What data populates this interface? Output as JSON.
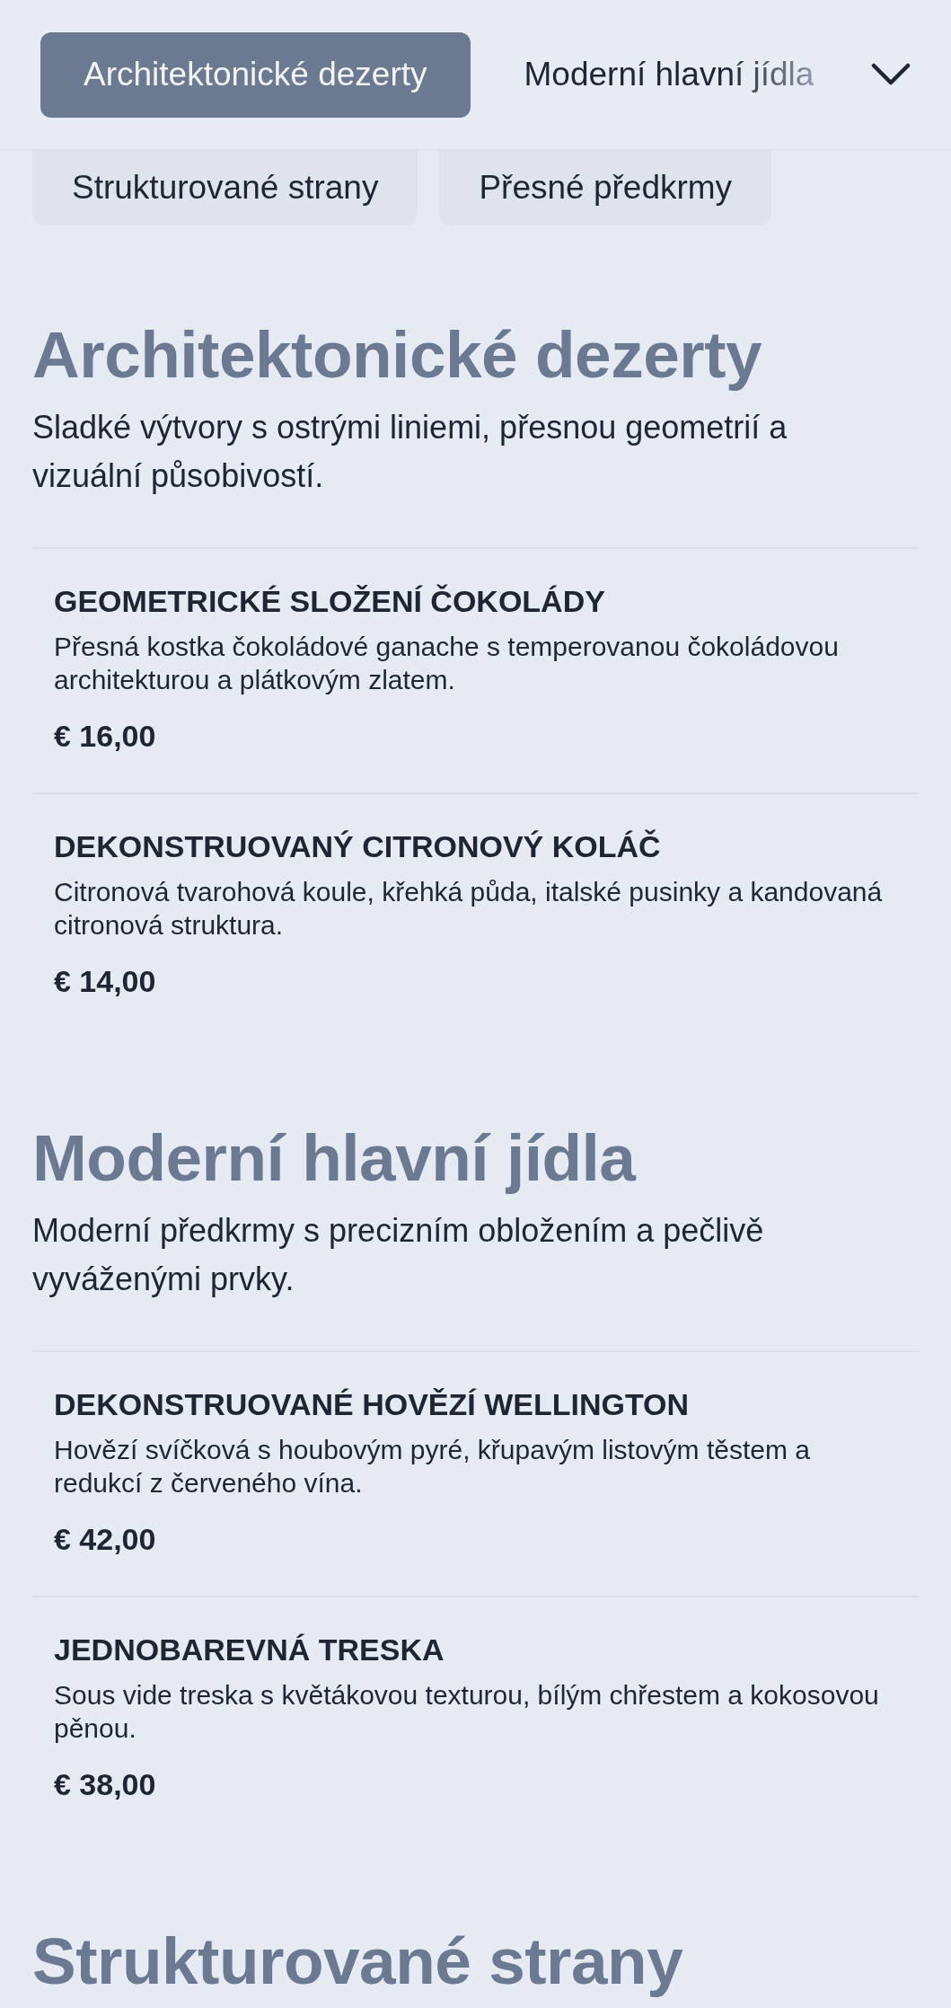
{
  "tabs": [
    {
      "label": "Architektonické dezerty",
      "selected": true
    },
    {
      "label": "Moderní hlavní jídla",
      "selected": false
    },
    {
      "label": "Strukturované strany",
      "selected": false
    },
    {
      "label": "Přesné předkrmy",
      "selected": false
    }
  ],
  "sections": [
    {
      "title": "Architektonické dezerty",
      "description": "Sladké výtvory s ostrými liniemi, přesnou geometrií a vizuální působivostí.",
      "items": [
        {
          "name": "GEOMETRICKÉ SLOŽENÍ ČOKOLÁDY",
          "description": "Přesná kostka čokoládové ganache s temperovanou čokoládovou architekturou a plátkovým zlatem.",
          "price": "€ 16,00"
        },
        {
          "name": "DEKONSTRUOVANÝ CITRONOVÝ KOLÁČ",
          "description": "Citronová tvarohová koule, křehká půda, italské pusinky a kandovaná citronová struktura.",
          "price": "€ 14,00"
        }
      ]
    },
    {
      "title": "Moderní hlavní jídla",
      "description": "Moderní předkrmy s precizním obložením a pečlivě vyváženými prvky.",
      "items": [
        {
          "name": "DEKONSTRUOVANÉ HOVĚZÍ WELLINGTON",
          "description": "Hovězí svíčková s houbovým pyré, křupavým listovým těstem a redukcí z červeného vína.",
          "price": "€ 42,00"
        },
        {
          "name": "JEDNOBAREVNÁ TRESKA",
          "description": "Sous vide treska s květákovou texturou, bílým chřestem a kokosovou pěnou.",
          "price": "€ 38,00"
        }
      ]
    },
    {
      "title": "Strukturované strany"
    }
  ]
}
